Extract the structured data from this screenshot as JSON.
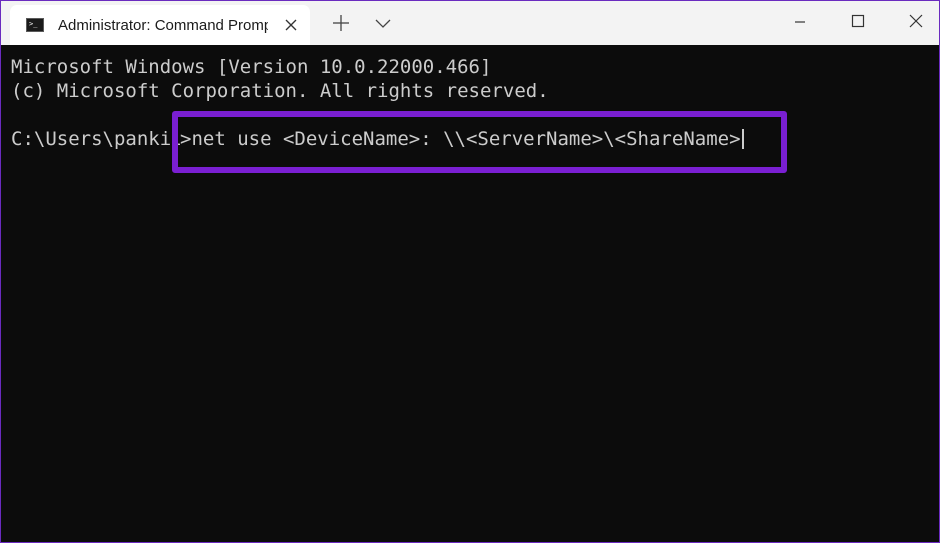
{
  "window": {
    "tab_title": "Administrator: Command Prompt",
    "tab_icon": "command-prompt-icon",
    "tab_icon_glyph": ">_"
  },
  "console": {
    "lines": [
      "Microsoft Windows [Version 10.0.22000.466]",
      "(c) Microsoft Corporation. All rights reserved."
    ],
    "prompt": "C:\\Users\\pankil",
    "command": ">net use <DeviceName>: \\\\<ServerName>\\<ShareName>"
  },
  "colors": {
    "highlight": "#7a1fd2",
    "console_bg": "#0c0c0c",
    "console_text": "#cccccc",
    "titlebar_bg": "#f3f3f3"
  }
}
